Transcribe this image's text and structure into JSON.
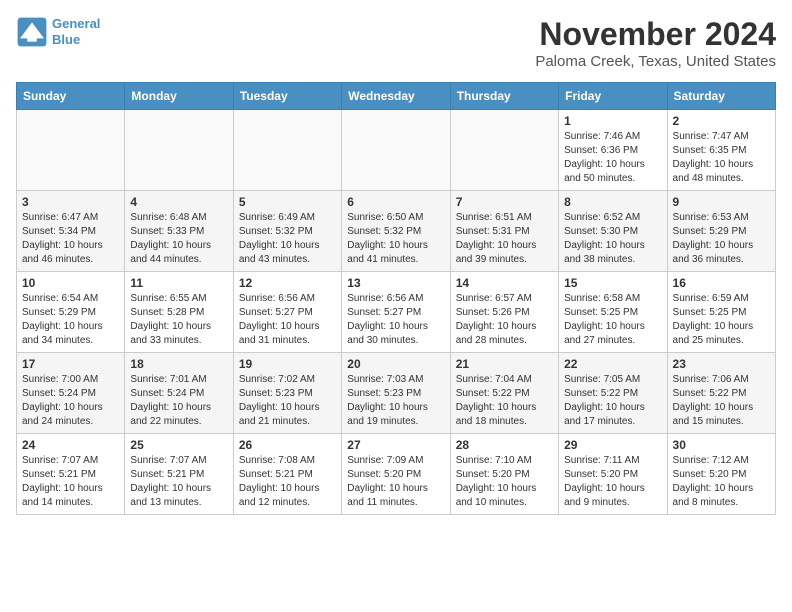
{
  "header": {
    "logo_line1": "General",
    "logo_line2": "Blue",
    "title": "November 2024",
    "subtitle": "Paloma Creek, Texas, United States"
  },
  "calendar": {
    "days_of_week": [
      "Sunday",
      "Monday",
      "Tuesday",
      "Wednesday",
      "Thursday",
      "Friday",
      "Saturday"
    ],
    "weeks": [
      [
        {
          "day": "",
          "info": ""
        },
        {
          "day": "",
          "info": ""
        },
        {
          "day": "",
          "info": ""
        },
        {
          "day": "",
          "info": ""
        },
        {
          "day": "",
          "info": ""
        },
        {
          "day": "1",
          "info": "Sunrise: 7:46 AM\nSunset: 6:36 PM\nDaylight: 10 hours\nand 50 minutes."
        },
        {
          "day": "2",
          "info": "Sunrise: 7:47 AM\nSunset: 6:35 PM\nDaylight: 10 hours\nand 48 minutes."
        }
      ],
      [
        {
          "day": "3",
          "info": "Sunrise: 6:47 AM\nSunset: 5:34 PM\nDaylight: 10 hours\nand 46 minutes."
        },
        {
          "day": "4",
          "info": "Sunrise: 6:48 AM\nSunset: 5:33 PM\nDaylight: 10 hours\nand 44 minutes."
        },
        {
          "day": "5",
          "info": "Sunrise: 6:49 AM\nSunset: 5:32 PM\nDaylight: 10 hours\nand 43 minutes."
        },
        {
          "day": "6",
          "info": "Sunrise: 6:50 AM\nSunset: 5:32 PM\nDaylight: 10 hours\nand 41 minutes."
        },
        {
          "day": "7",
          "info": "Sunrise: 6:51 AM\nSunset: 5:31 PM\nDaylight: 10 hours\nand 39 minutes."
        },
        {
          "day": "8",
          "info": "Sunrise: 6:52 AM\nSunset: 5:30 PM\nDaylight: 10 hours\nand 38 minutes."
        },
        {
          "day": "9",
          "info": "Sunrise: 6:53 AM\nSunset: 5:29 PM\nDaylight: 10 hours\nand 36 minutes."
        }
      ],
      [
        {
          "day": "10",
          "info": "Sunrise: 6:54 AM\nSunset: 5:29 PM\nDaylight: 10 hours\nand 34 minutes."
        },
        {
          "day": "11",
          "info": "Sunrise: 6:55 AM\nSunset: 5:28 PM\nDaylight: 10 hours\nand 33 minutes."
        },
        {
          "day": "12",
          "info": "Sunrise: 6:56 AM\nSunset: 5:27 PM\nDaylight: 10 hours\nand 31 minutes."
        },
        {
          "day": "13",
          "info": "Sunrise: 6:56 AM\nSunset: 5:27 PM\nDaylight: 10 hours\nand 30 minutes."
        },
        {
          "day": "14",
          "info": "Sunrise: 6:57 AM\nSunset: 5:26 PM\nDaylight: 10 hours\nand 28 minutes."
        },
        {
          "day": "15",
          "info": "Sunrise: 6:58 AM\nSunset: 5:25 PM\nDaylight: 10 hours\nand 27 minutes."
        },
        {
          "day": "16",
          "info": "Sunrise: 6:59 AM\nSunset: 5:25 PM\nDaylight: 10 hours\nand 25 minutes."
        }
      ],
      [
        {
          "day": "17",
          "info": "Sunrise: 7:00 AM\nSunset: 5:24 PM\nDaylight: 10 hours\nand 24 minutes."
        },
        {
          "day": "18",
          "info": "Sunrise: 7:01 AM\nSunset: 5:24 PM\nDaylight: 10 hours\nand 22 minutes."
        },
        {
          "day": "19",
          "info": "Sunrise: 7:02 AM\nSunset: 5:23 PM\nDaylight: 10 hours\nand 21 minutes."
        },
        {
          "day": "20",
          "info": "Sunrise: 7:03 AM\nSunset: 5:23 PM\nDaylight: 10 hours\nand 19 minutes."
        },
        {
          "day": "21",
          "info": "Sunrise: 7:04 AM\nSunset: 5:22 PM\nDaylight: 10 hours\nand 18 minutes."
        },
        {
          "day": "22",
          "info": "Sunrise: 7:05 AM\nSunset: 5:22 PM\nDaylight: 10 hours\nand 17 minutes."
        },
        {
          "day": "23",
          "info": "Sunrise: 7:06 AM\nSunset: 5:22 PM\nDaylight: 10 hours\nand 15 minutes."
        }
      ],
      [
        {
          "day": "24",
          "info": "Sunrise: 7:07 AM\nSunset: 5:21 PM\nDaylight: 10 hours\nand 14 minutes."
        },
        {
          "day": "25",
          "info": "Sunrise: 7:07 AM\nSunset: 5:21 PM\nDaylight: 10 hours\nand 13 minutes."
        },
        {
          "day": "26",
          "info": "Sunrise: 7:08 AM\nSunset: 5:21 PM\nDaylight: 10 hours\nand 12 minutes."
        },
        {
          "day": "27",
          "info": "Sunrise: 7:09 AM\nSunset: 5:20 PM\nDaylight: 10 hours\nand 11 minutes."
        },
        {
          "day": "28",
          "info": "Sunrise: 7:10 AM\nSunset: 5:20 PM\nDaylight: 10 hours\nand 10 minutes."
        },
        {
          "day": "29",
          "info": "Sunrise: 7:11 AM\nSunset: 5:20 PM\nDaylight: 10 hours\nand 9 minutes."
        },
        {
          "day": "30",
          "info": "Sunrise: 7:12 AM\nSunset: 5:20 PM\nDaylight: 10 hours\nand 8 minutes."
        }
      ]
    ]
  }
}
